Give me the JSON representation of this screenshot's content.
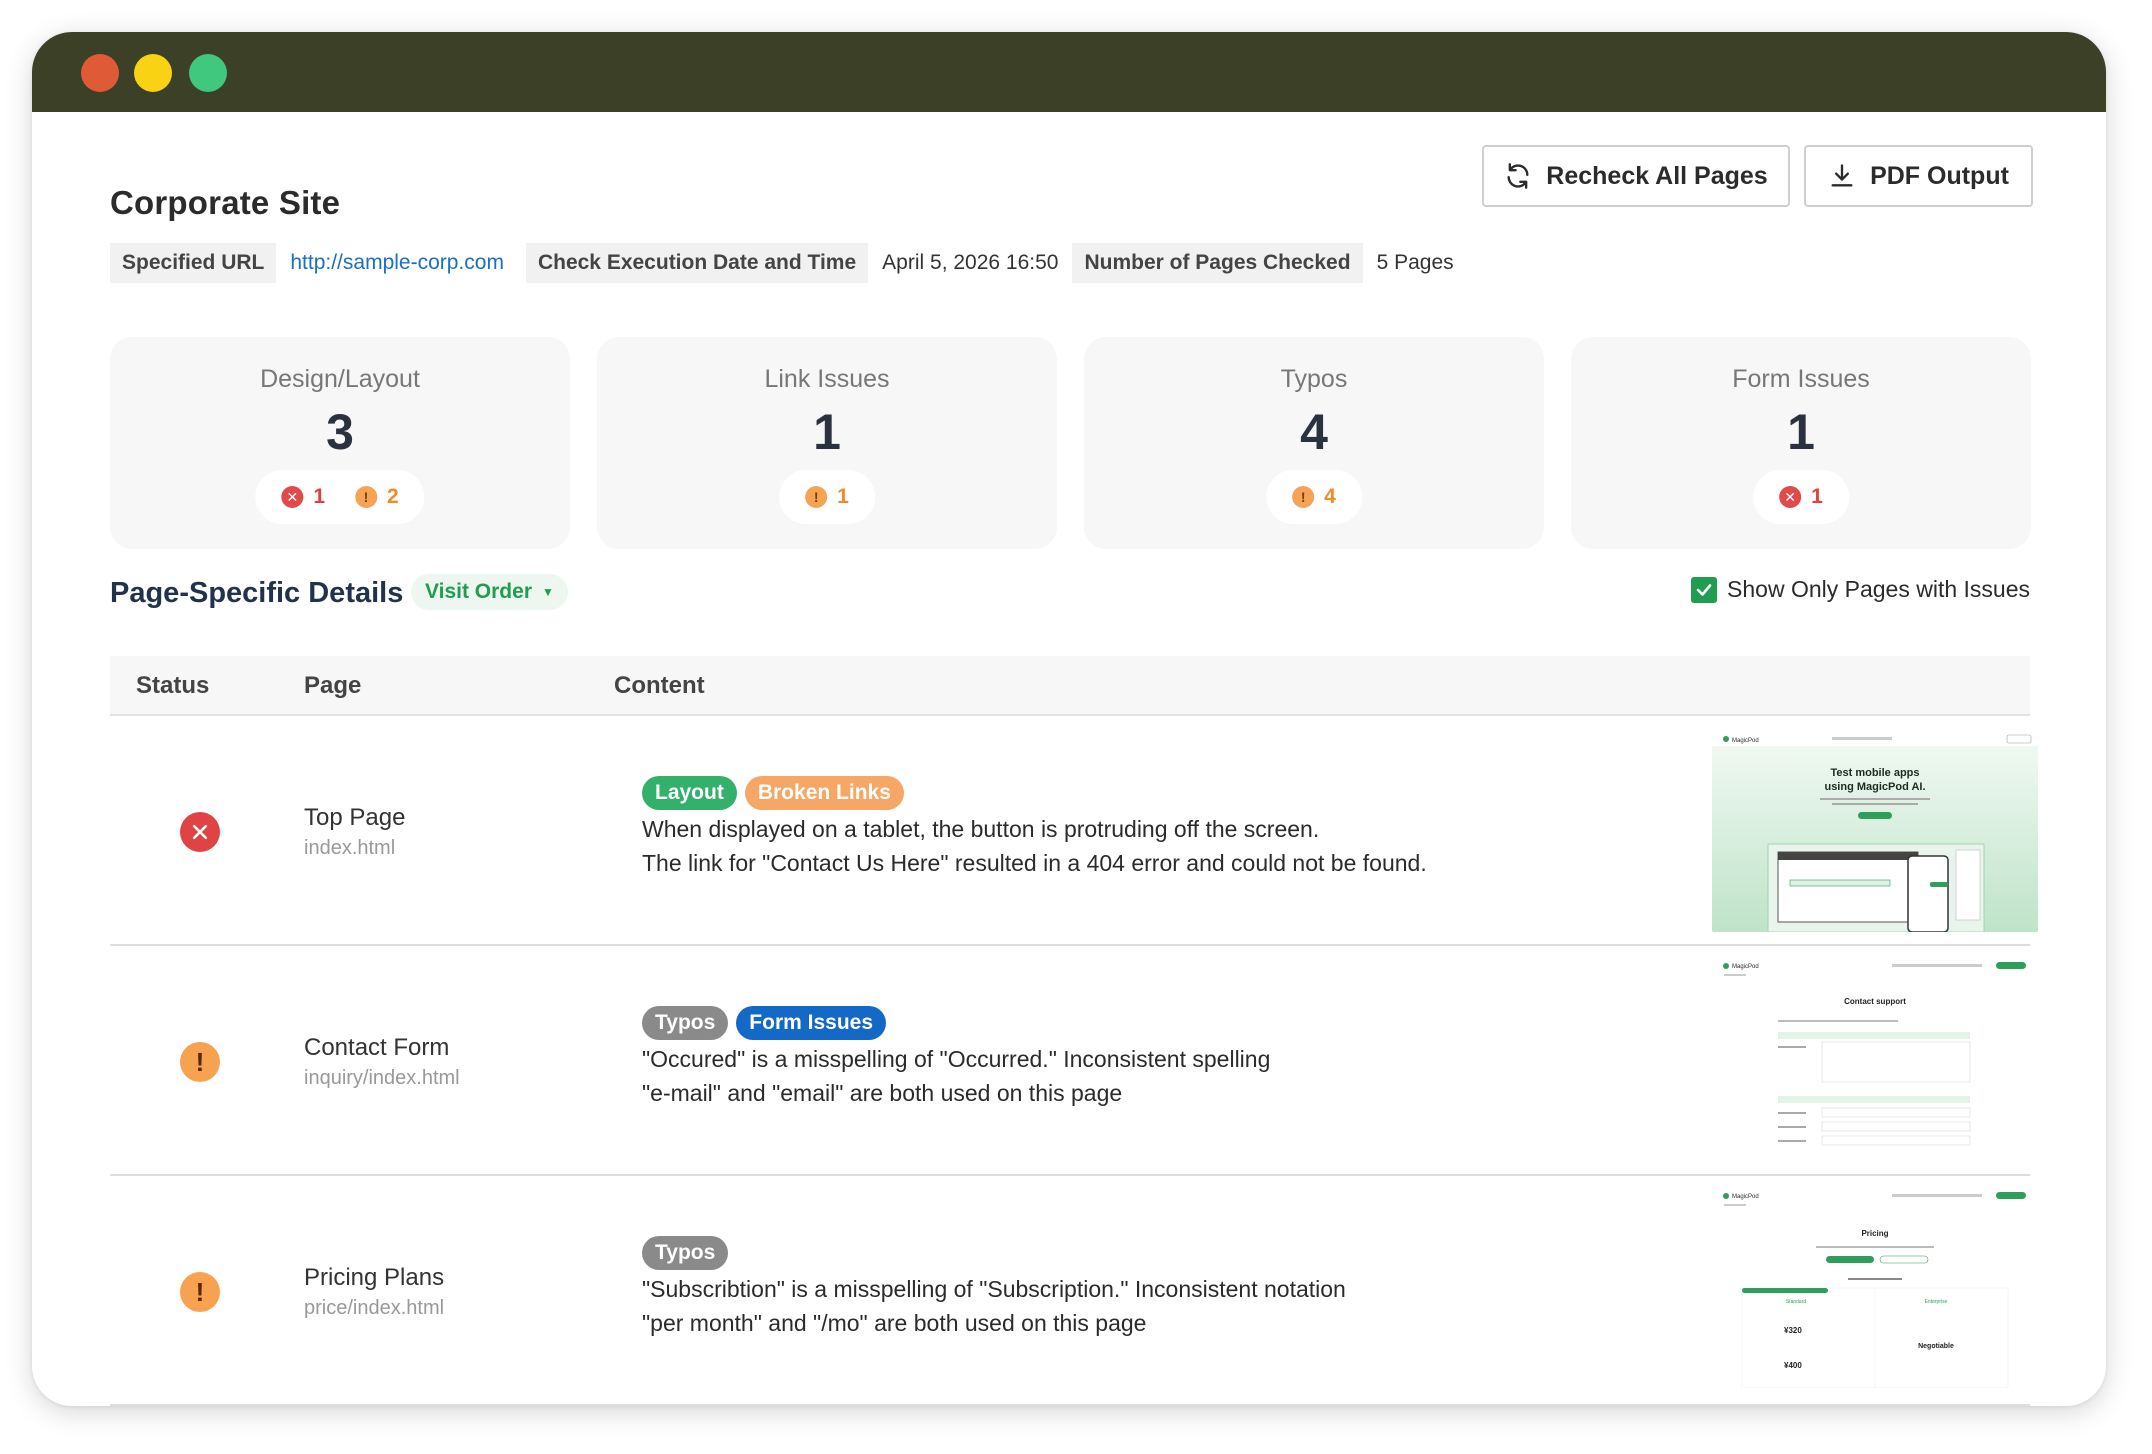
{
  "window": {
    "controls": [
      "close",
      "minimize",
      "maximize"
    ]
  },
  "header": {
    "site_title": "Corporate Site",
    "recheck_label": "Recheck All Pages",
    "pdf_label": "PDF Output"
  },
  "meta": {
    "url_label": "Specified URL",
    "url_value": "http://sample-corp.com",
    "date_label": "Check Execution Date and Time",
    "date_value": "April 5, 2026 16:50",
    "pages_label": "Number of Pages Checked",
    "pages_value": "5 Pages"
  },
  "summary": [
    {
      "label": "Design/Layout",
      "count": "3",
      "errors": "1",
      "warnings": "2"
    },
    {
      "label": "Link Issues",
      "count": "1",
      "warnings": "1"
    },
    {
      "label": "Typos",
      "count": "4",
      "warnings": "4"
    },
    {
      "label": "Form Issues",
      "count": "1",
      "errors": "1"
    }
  ],
  "details": {
    "title": "Page-Specific Details",
    "sort_value": "Visit Order",
    "show_only_label": "Show Only Pages with Issues",
    "show_only_checked": true,
    "columns": {
      "status": "Status",
      "page": "Page",
      "content": "Content"
    },
    "rows": [
      {
        "status": "error",
        "page_name": "Top Page",
        "page_path": "index.html",
        "tags": [
          "Layout",
          "Broken Links"
        ],
        "lines": [
          "When displayed on a tablet, the button is protruding off the screen.",
          "The link for \"Contact Us Here\" resulted in a 404 error and could not be found."
        ],
        "thumbnail": {
          "brand": "MagicPod",
          "headline_1": "Test mobile apps",
          "headline_2": "using MagicPod AI."
        }
      },
      {
        "status": "warning",
        "page_name": "Contact Form",
        "page_path": "inquiry/index.html",
        "tags": [
          "Typos",
          "Form Issues"
        ],
        "lines": [
          "\"Occured\" is a misspelling of \"Occurred.\" Inconsistent spelling",
          "\"e-mail\" and \"email\" are both used on this page"
        ],
        "thumbnail": {
          "brand": "MagicPod",
          "heading": "Contact support"
        }
      },
      {
        "status": "warning",
        "page_name": "Pricing Plans",
        "page_path": "price/index.html",
        "tags": [
          "Typos"
        ],
        "lines": [
          "\"Subscribtion\" is a misspelling of \"Subscription.\" Inconsistent notation",
          "\"per month\" and \"/mo\" are both used on this page"
        ],
        "thumbnail": {
          "brand": "MagicPod",
          "heading": "Pricing",
          "plan_1": "Standard",
          "plan_2": "Enterprise",
          "price_1": "¥320",
          "price_2": "¥400",
          "plan_2_price": "Negotiable"
        }
      }
    ]
  },
  "colors": {
    "titlebar": "#3b4027",
    "error": "#e04343",
    "warning": "#f6a250",
    "accent_green": "#1f9d50",
    "form_tag": "#1468c6"
  }
}
